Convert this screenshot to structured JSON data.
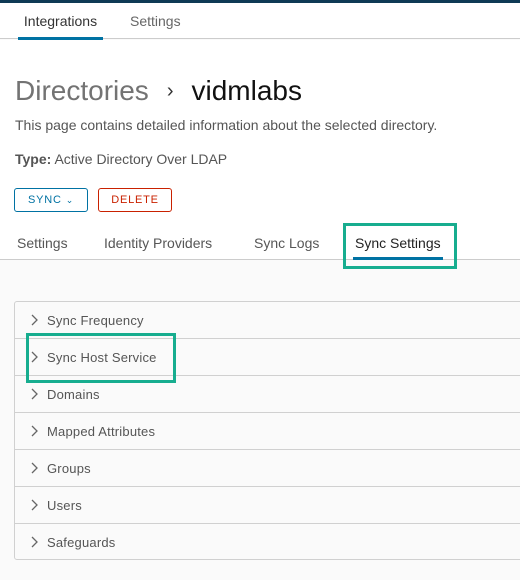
{
  "top_nav": {
    "tabs": [
      {
        "label": "Integrations",
        "active": true
      },
      {
        "label": "Settings",
        "active": false
      }
    ]
  },
  "header": {
    "breadcrumb_parent": "Directories",
    "breadcrumb_separator": "›",
    "title": "vidmlabs",
    "description": "This page contains detailed information about the selected directory.",
    "type_label": "Type:",
    "type_value": "Active Directory Over LDAP"
  },
  "actions": {
    "sync_label": "SYNC",
    "sync_icon": "chevron-down-icon",
    "delete_label": "DELETE"
  },
  "sub_tabs": [
    {
      "label": "Settings",
      "active": false
    },
    {
      "label": "Identity Providers",
      "active": false
    },
    {
      "label": "Sync Logs",
      "active": false
    },
    {
      "label": "Sync Settings",
      "active": true
    }
  ],
  "accordion": {
    "icon": "chevron-right-icon",
    "items": [
      {
        "label": "Sync Frequency"
      },
      {
        "label": "Sync Host Service"
      },
      {
        "label": "Domains"
      },
      {
        "label": "Mapped Attributes"
      },
      {
        "label": "Groups"
      },
      {
        "label": "Users"
      },
      {
        "label": "Safeguards"
      }
    ]
  },
  "colors": {
    "accent": "#0072a3",
    "danger": "#c92100",
    "highlight": "#17ad8f",
    "topbar": "#0e3a55"
  }
}
